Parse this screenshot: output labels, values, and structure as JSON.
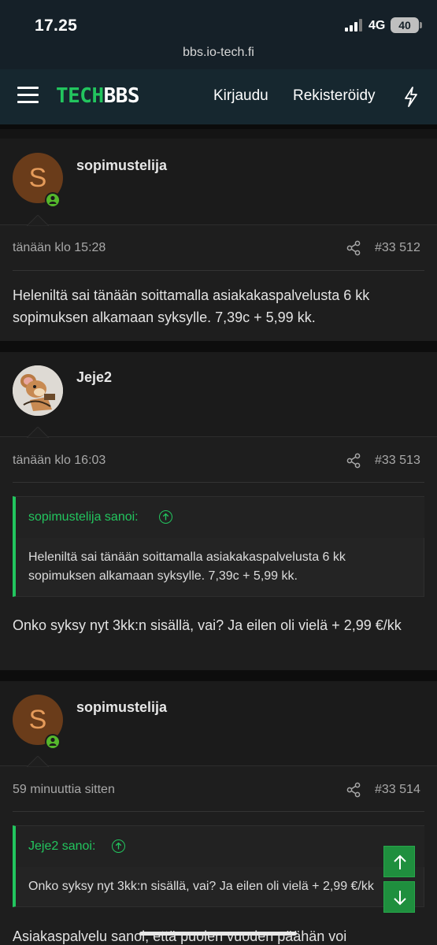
{
  "status_bar": {
    "time": "17.25",
    "network": "4G",
    "battery": "40"
  },
  "browser": {
    "url": "bbs.io-tech.fi"
  },
  "header": {
    "logo_part1": "TECH",
    "logo_part2": "BBS",
    "login_label": "Kirjaudu",
    "register_label": "Rekisteröidy",
    "bolt_icon": "bolt-icon",
    "menu_icon": "hamburger-menu-icon"
  },
  "posts": [
    {
      "avatar_letter": "S",
      "username": "sopimustelija",
      "date": "tänään klo 15:28",
      "number": "#33 512",
      "body": "Heleniltä sai tänään soittamalla asiakakaspalvelusta 6 kk sopimuksen alkamaan syksylle. 7,39c + 5,99 kk."
    },
    {
      "avatar_letter": "",
      "username": "Jeje2",
      "date": "tänään klo 16:03",
      "number": "#33 513",
      "quote_author": "sopimustelija sanoi:",
      "quote_text": "Heleniltä sai tänään soittamalla asiakakaspalvelusta 6 kk sopimuksen alkamaan syksylle. 7,39c + 5,99 kk.",
      "body": "Onko syksy nyt 3kk:n sisällä, vai? Ja eilen oli vielä + 2,99 €/kk"
    },
    {
      "avatar_letter": "S",
      "username": "sopimustelija",
      "date": "59 minuuttia sitten",
      "number": "#33 514",
      "quote_author": "Jeje2 sanoi:",
      "quote_text": "Onko syksy nyt 3kk:n sisällä, vai? Ja eilen oli vielä + 2,99 €/kk",
      "body": "Asiakaspalvelu sanoi, että puolen vuoden päähän voi"
    }
  ],
  "colors": {
    "accent": "#22c55e",
    "header_bg": "#16272f",
    "avatar_bg": "#6a3c1a"
  }
}
